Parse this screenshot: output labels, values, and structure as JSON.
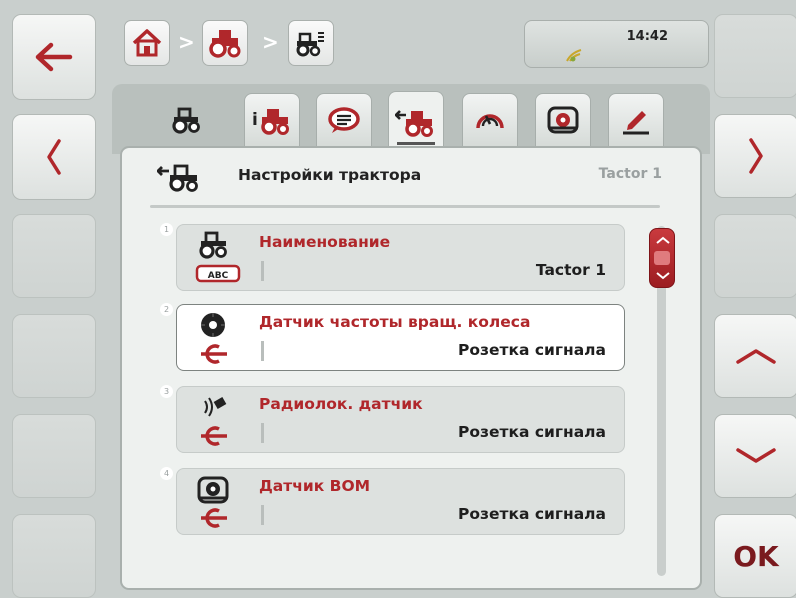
{
  "header": {
    "time": "14:42",
    "breadcrumb": [
      {
        "name": "home-icon"
      },
      {
        "name": "tractor-icon"
      },
      {
        "name": "tractor-implement-icon"
      }
    ],
    "separator": ">"
  },
  "tabs": [
    {
      "name": "tractor-icon",
      "active": false
    },
    {
      "name": "tractor-info-icon",
      "active": false
    },
    {
      "name": "speech-bubble-icon",
      "active": false
    },
    {
      "name": "tractor-settings-icon",
      "active": true
    },
    {
      "name": "gauge-icon",
      "active": false
    },
    {
      "name": "pto-icon",
      "active": false
    },
    {
      "name": "pencil-icon",
      "active": false
    }
  ],
  "panel": {
    "title": "Настройки трактора",
    "subtitle": "Tactor 1"
  },
  "items": [
    {
      "number": "1",
      "label": "Наименование",
      "value": "Tactor 1",
      "selected": false
    },
    {
      "number": "2",
      "label": "Датчик частоты вращ. колеса",
      "value": "Розетка сигнала",
      "selected": true
    },
    {
      "number": "3",
      "label": "Радиолок. датчик",
      "value": "Розетка сигнала",
      "selected": false
    },
    {
      "number": "4",
      "label": "Датчик ВОМ",
      "value": "Розетка сигнала",
      "selected": false
    }
  ],
  "softkeys": {
    "ok_label": "OK"
  },
  "colors": {
    "accent": "#b0272b",
    "background": "#c9cfcd",
    "panel": "#eef1ef"
  }
}
